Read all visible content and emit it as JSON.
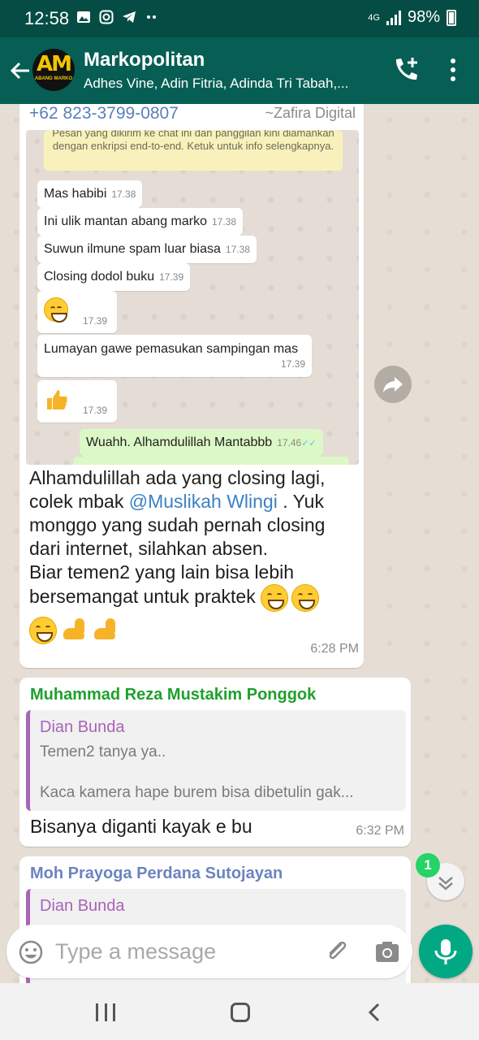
{
  "status_bar": {
    "time": "12:58",
    "network": "4G",
    "battery": "98%",
    "notif_icons": [
      "gallery-icon",
      "instagram-icon",
      "telegram-icon",
      "more-dots-icon"
    ]
  },
  "header": {
    "title": "Markopolitan",
    "members": "Adhes Vine, Adin Fitria, Adinda Tri Tabah,...",
    "avatar_text": "AM",
    "avatar_subtext": "ABANG MARKO"
  },
  "messages": [
    {
      "phone": "+62 823-3799-0807",
      "push_name": "~Zafira Digital",
      "screenshot": {
        "encryption_note": "Pesan yang dikirim ke chat ini dan panggilan kini diamankan dengan enkripsi end-to-end. Ketuk untuk info selengkapnya.",
        "items": [
          {
            "text": "Mas habibi",
            "time": "17.38"
          },
          {
            "text": "Ini ulik mantan abang marko",
            "time": "17.38"
          },
          {
            "text": "Suwun ilmune spam luar biasa",
            "time": "17.38"
          },
          {
            "text": "Closing dodol buku",
            "time": "17.39"
          },
          {
            "text": "",
            "time": "17.39"
          },
          {
            "text": "Lumayan gawe pemasukan sampingan mas",
            "time": "17.39"
          },
          {
            "text": "",
            "time": "17.39"
          }
        ],
        "outgoing": {
          "text": "Wuahh. Alhamdulillah  Mantabbb",
          "time": "17.46"
        }
      },
      "text_part1": "Alhamdulillah  ada yang closing lagi, colek mbak ",
      "mention": "@Muslikah Wlingi",
      "text_part2": " . Yuk monggo yang sudah pernah closing dari internet, silahkan absen.",
      "text_part3": "Biar temen2 yang lain bisa lebih bersemangat untuk praktek",
      "time": "6:28 PM"
    },
    {
      "sender": "Muhammad Reza Mustakim Ponggok",
      "sender_color": "#1fa02c",
      "quote_name": "Dian Bunda",
      "quote_line1": "Temen2 tanya ya..",
      "quote_line2": "Kaca kamera hape burem bisa dibetulin gak...",
      "text": "Bisanya diganti kayak e bu",
      "time": "6:32 PM"
    },
    {
      "sender": "Moh Prayoga Perdana Sutojayan",
      "sender_color": "#6b84c0",
      "quote_name": "Dian Bunda"
    }
  ],
  "unread_badge": "1",
  "input": {
    "placeholder": "Type a message"
  },
  "colors": {
    "header": "#075e54",
    "status": "#054d44",
    "accent": "#00a884",
    "badge": "#25d366"
  }
}
